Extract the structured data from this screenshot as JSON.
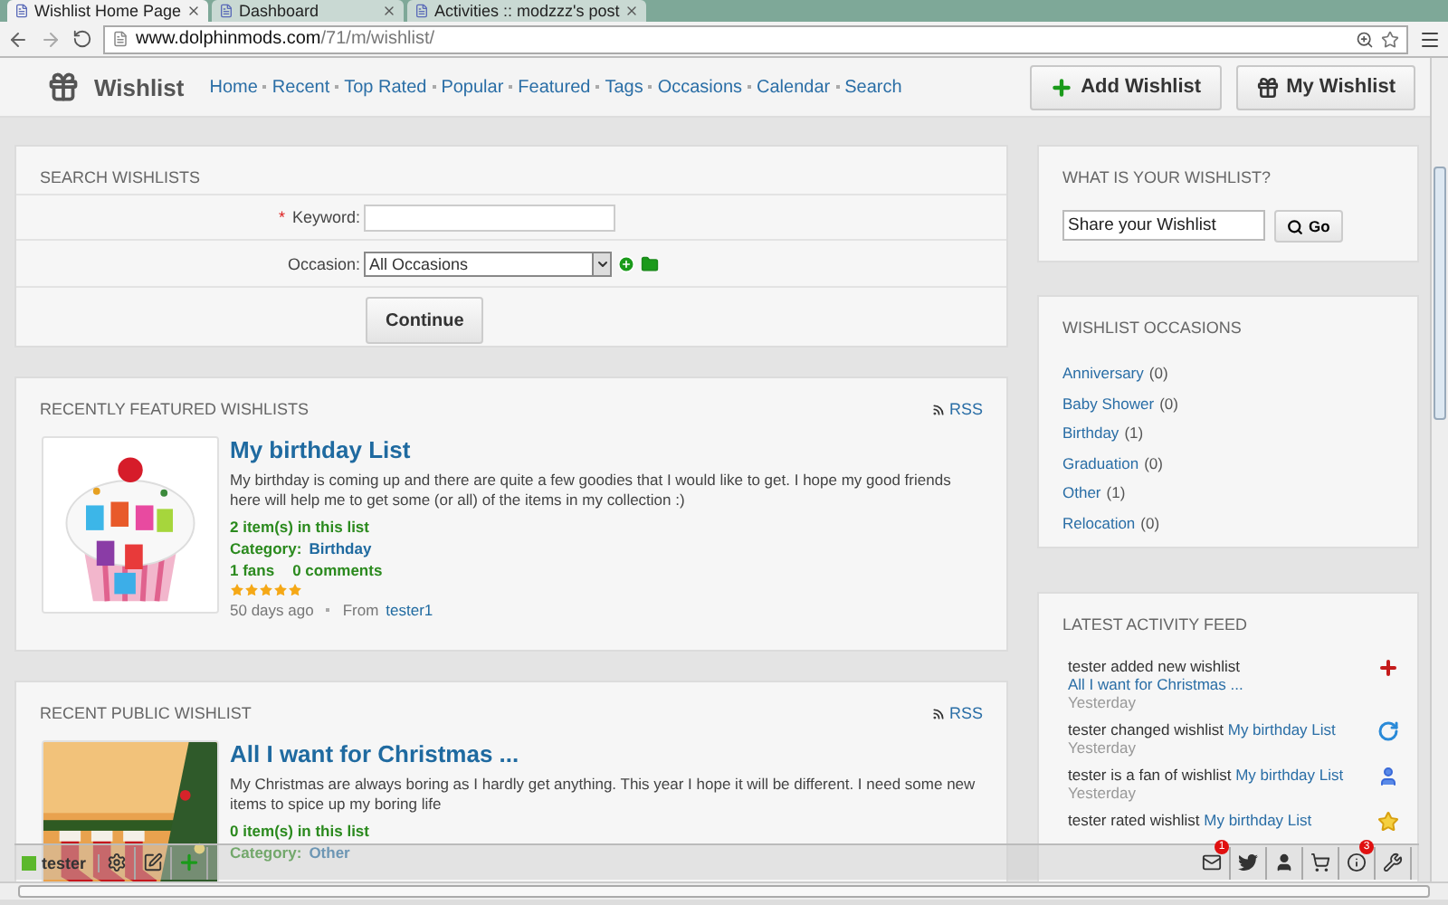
{
  "browser": {
    "tabs": [
      {
        "title": "Wishlist Home Page",
        "selected": true
      },
      {
        "title": "Dashboard",
        "selected": false
      },
      {
        "title": "Activities :: modzzz's post",
        "selected": false
      }
    ],
    "url_host": "www.dolphinmods.com",
    "url_path": "/71/m/wishlist/"
  },
  "header": {
    "title": "Wishlist",
    "nav": [
      "Home",
      "Recent",
      "Top Rated",
      "Popular",
      "Featured",
      "Tags",
      "Occasions",
      "Calendar",
      "Search"
    ],
    "buttons": [
      {
        "kind": "add",
        "label": "Add Wishlist"
      },
      {
        "kind": "gift",
        "label": "My Wishlist"
      }
    ]
  },
  "search": {
    "title": "SEARCH WISHLISTS",
    "required_mark": "*",
    "keyword_label": "Keyword:",
    "occasion_label": "Occasion:",
    "occasion_value": "All Occasions",
    "submit": "Continue"
  },
  "featured": {
    "title": "RECENTLY FEATURED WISHLISTS",
    "rss": "RSS",
    "item": {
      "title": "My birthday List",
      "description": "My birthday is coming up and there are quite a few goodies that I would like to get. I hope my good friends here will help me to get some (or all) of the items in my collection :)",
      "items": "2 item(s) in this list",
      "category_label": "Category:",
      "category": "Birthday",
      "fans": "1 fans",
      "comments": "0 comments",
      "stars": 5,
      "age": "50 days ago",
      "from_label": "From",
      "author": "tester1"
    }
  },
  "public": {
    "title": "RECENT PUBLIC WISHLIST",
    "rss": "RSS",
    "item": {
      "title": "All I want for Christmas ...",
      "description": "My Christmas are always boring as I hardly get anything. This year I hope it will be different. I need some new items to spice up my boring life",
      "items": "0 item(s) in this list",
      "category_label": "Category:",
      "category": "Other"
    }
  },
  "share": {
    "title": "WHAT IS YOUR WISHLIST?",
    "value": "Share your Wishlist",
    "button": "Go"
  },
  "occasions": {
    "title": "WISHLIST OCCASIONS",
    "items": [
      {
        "name": "Anniversary",
        "count": "(0)"
      },
      {
        "name": "Baby Shower",
        "count": "(0)"
      },
      {
        "name": "Birthday",
        "count": "(1)"
      },
      {
        "name": "Graduation",
        "count": "(0)"
      },
      {
        "name": "Other",
        "count": "(1)"
      },
      {
        "name": "Relocation",
        "count": "(0)"
      }
    ]
  },
  "feed": {
    "title": "LATEST ACTIVITY FEED",
    "items": [
      {
        "kind": "added",
        "text": "tester added new wishlist ",
        "target": "All I want for Christmas ...",
        "time": "Yesterday"
      },
      {
        "kind": "changed",
        "text": "tester changed wishlist ",
        "target": "My birthday List",
        "time": "Yesterday"
      },
      {
        "kind": "fan",
        "text": "tester is a fan of wishlist ",
        "target": "My birthday List",
        "time": "Yesterday"
      },
      {
        "kind": "rated",
        "text": "tester rated wishlist ",
        "target": "My birthday List"
      }
    ]
  },
  "toolbar": {
    "user": "tester",
    "left": [
      {
        "kind": "settings"
      },
      {
        "kind": "edit"
      },
      {
        "kind": "add"
      }
    ],
    "right": [
      {
        "kind": "mail",
        "badge": "1"
      },
      {
        "kind": "twitter"
      },
      {
        "kind": "user"
      },
      {
        "kind": "cart"
      },
      {
        "kind": "info",
        "badge": "3"
      },
      {
        "kind": "tools"
      }
    ]
  }
}
